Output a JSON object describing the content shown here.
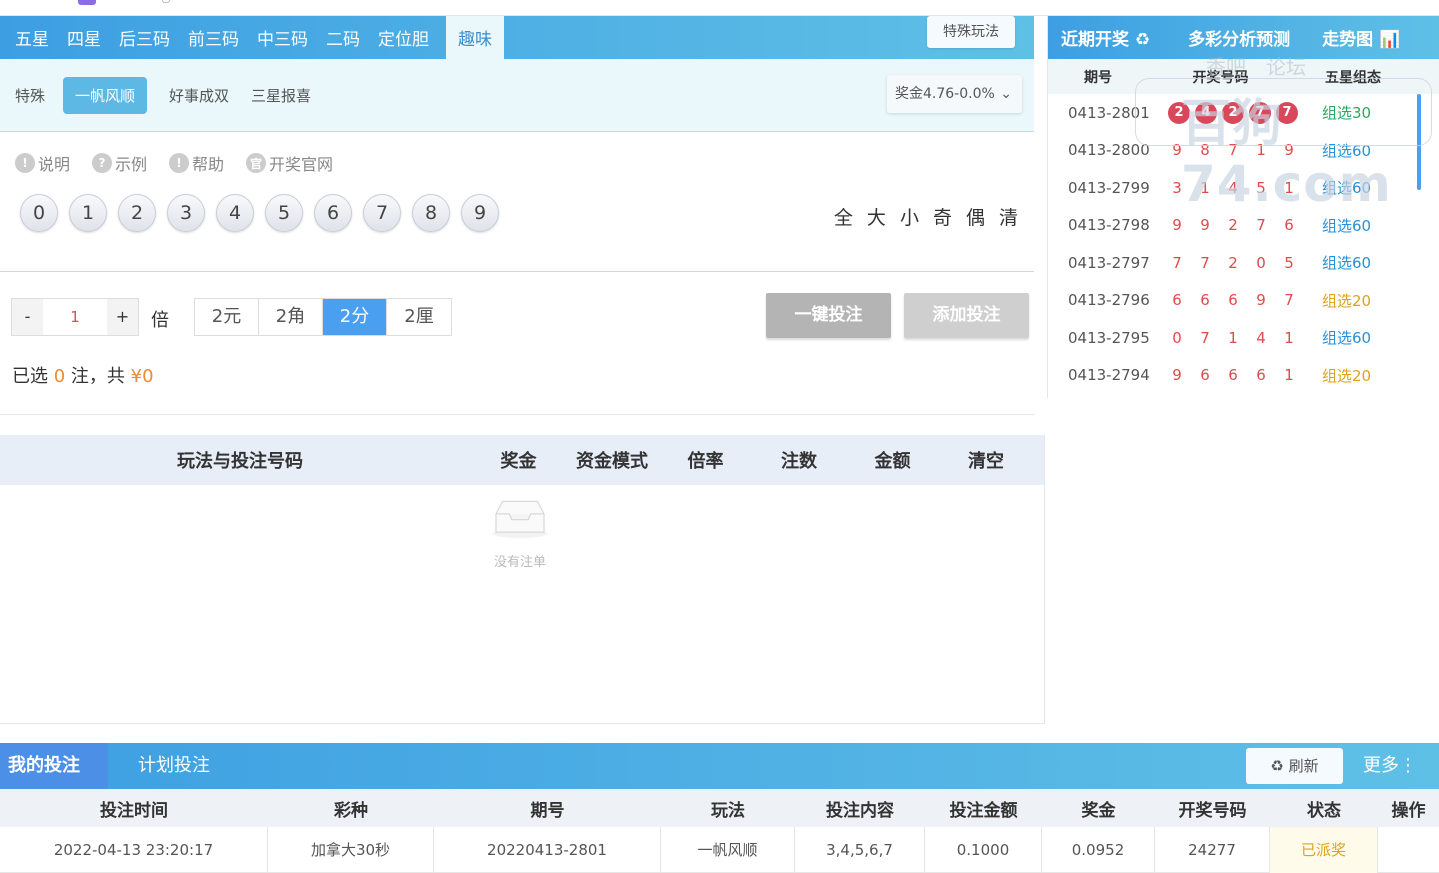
{
  "tabs": [
    "五星",
    "四星",
    "后三码",
    "前三码",
    "中三码",
    "二码",
    "定位胆",
    "趣味"
  ],
  "special_btn": "特殊玩法",
  "subtabs": [
    "特殊",
    "一帆风顺",
    "好事成双",
    "三星报喜"
  ],
  "prize_select": "奖金4.76-0.0%",
  "info_links": [
    {
      "icon": "!",
      "label": "说明",
      "icon_name": "exclamation-icon"
    },
    {
      "icon": "?",
      "label": "示例",
      "icon_name": "question-icon"
    },
    {
      "icon": "!",
      "label": "帮助",
      "icon_name": "exclamation-icon"
    },
    {
      "icon": "官",
      "label": "开奖官网",
      "icon_name": "official-icon"
    }
  ],
  "balls": [
    "0",
    "1",
    "2",
    "3",
    "4",
    "5",
    "6",
    "7",
    "8",
    "9"
  ],
  "quick": [
    "全",
    "大",
    "小",
    "奇",
    "偶",
    "清"
  ],
  "multiplier": {
    "minus": "-",
    "value": "1",
    "plus": "+",
    "unit": "倍"
  },
  "units": [
    "2元",
    "2角",
    "2分",
    "2厘"
  ],
  "quick_bet": "一键投注",
  "add_bet": "添加投注",
  "summary": {
    "prefix": "已选",
    "count": "0",
    "mid": "注，共",
    "amount": "¥0"
  },
  "right_panel": {
    "head": [
      "近期开奖 ♻",
      "多彩分析预测",
      "走势图 📊"
    ],
    "cols": [
      "期号",
      "开奖号码",
      "五星组态"
    ],
    "rows": [
      {
        "issue": "0413-2801",
        "nums": [
          "2",
          "4",
          "2",
          "7",
          "7"
        ],
        "group": "组选30",
        "color": "#2aa85f"
      },
      {
        "issue": "0413-2800",
        "nums": [
          "9",
          "8",
          "7",
          "1",
          "9"
        ],
        "group": "组选60",
        "color": "#2690d8"
      },
      {
        "issue": "0413-2799",
        "nums": [
          "3",
          "1",
          "4",
          "5",
          "1"
        ],
        "group": "组选60",
        "color": "#2690d8"
      },
      {
        "issue": "0413-2798",
        "nums": [
          "9",
          "9",
          "2",
          "7",
          "6"
        ],
        "group": "组选60",
        "color": "#2690d8"
      },
      {
        "issue": "0413-2797",
        "nums": [
          "7",
          "7",
          "2",
          "0",
          "5"
        ],
        "group": "组选60",
        "color": "#2690d8"
      },
      {
        "issue": "0413-2796",
        "nums": [
          "6",
          "6",
          "6",
          "9",
          "7"
        ],
        "group": "组选20",
        "color": "#e0a020"
      },
      {
        "issue": "0413-2795",
        "nums": [
          "0",
          "7",
          "1",
          "4",
          "1"
        ],
        "group": "组选60",
        "color": "#2690d8"
      },
      {
        "issue": "0413-2794",
        "nums": [
          "9",
          "6",
          "6",
          "6",
          "1"
        ],
        "group": "组选20",
        "color": "#e0a020"
      }
    ],
    "watermark": "百狗74.com",
    "watermark_top": "香吧　论坛"
  },
  "ticket": {
    "cols": [
      "玩法与投注号码",
      "奖金",
      "资金模式",
      "倍率",
      "注数",
      "金额",
      "清空"
    ],
    "empty": "没有注单"
  },
  "bottom": {
    "tabs": [
      "我的投注",
      "计划投注"
    ],
    "refresh": "♻ 刷新",
    "more": "更多⋮",
    "cols": [
      "投注时间",
      "彩种",
      "期号",
      "玩法",
      "投注内容",
      "投注金额",
      "奖金",
      "开奖号码",
      "状态",
      "操作"
    ],
    "rows": [
      [
        "2022-04-13 23:20:17",
        "加拿大30秒",
        "20220413-2801",
        "一帆风顺",
        "3,4,5,6,7",
        "0.1000",
        "0.0952",
        "24277",
        "已派奖",
        ""
      ]
    ],
    "status_color": "#e0a020"
  }
}
